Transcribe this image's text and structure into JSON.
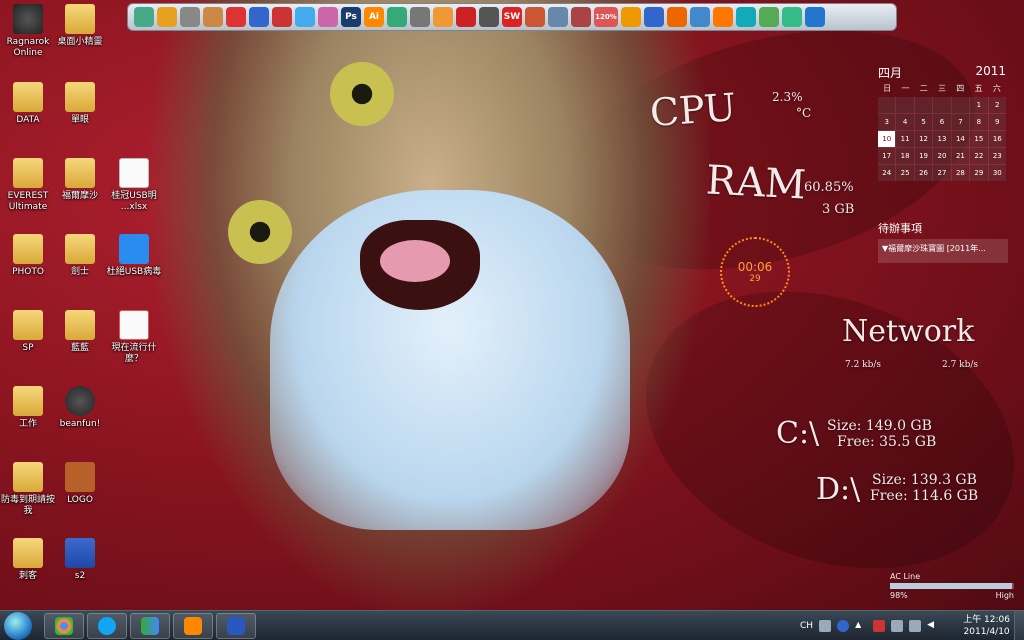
{
  "desktop_icons": [
    {
      "label": "Ragnarok Online",
      "type": "app"
    },
    {
      "label": "DATA",
      "type": "folder"
    },
    {
      "label": "EVEREST Ultimate",
      "type": "folder"
    },
    {
      "label": "PHOTO",
      "type": "folder"
    },
    {
      "label": "SP",
      "type": "folder"
    },
    {
      "label": "工作",
      "type": "folder"
    },
    {
      "label": "防毒到期請按我",
      "type": "folder"
    },
    {
      "label": "刺客",
      "type": "folder"
    },
    {
      "label": "桌面小精靈",
      "type": "folder"
    },
    {
      "label": "單眼",
      "type": "folder"
    },
    {
      "label": "福爾摩沙",
      "type": "folder"
    },
    {
      "label": "劍士",
      "type": "folder"
    },
    {
      "label": "藍藍",
      "type": "folder"
    },
    {
      "label": "beanfun!",
      "type": "app"
    },
    {
      "label": "LOGO",
      "type": "app"
    },
    {
      "label": "s2",
      "type": "doc"
    },
    {
      "label": "桂冠USB明 ...xlsx",
      "type": "doc"
    },
    {
      "label": "杜絕USB病毒",
      "type": "app"
    },
    {
      "label": "現在流行什麼？",
      "type": "doc"
    }
  ],
  "dock_icons": [
    "monitor-icon",
    "folder-icon",
    "pen-icon",
    "clipboard-icon",
    "tool-icon",
    "globe-icon",
    "toolbox-icon",
    "drop-icon",
    "paint-icon",
    "photoshop-icon",
    "illustrator-icon",
    "earth-icon",
    "gear-icon",
    "help-icon",
    "pdf-icon",
    "mouse-icon",
    "swf-icon",
    "capture-icon",
    "notepad-icon",
    "video-icon",
    "zoom-icon",
    "calc-icon",
    "media-icon",
    "camera-icon",
    "music-icon",
    "game-icon",
    "skype-icon",
    "messenger-icon",
    "chrome-icon",
    "ie-icon"
  ],
  "dock_labels": {
    "ps": "Ps",
    "ai": "Ai",
    "sw": "SW",
    "zoom": "120%"
  },
  "gadgets": {
    "cpu_label": "CPU",
    "cpu_value": "2.3%",
    "cpu_temp": "°C",
    "ram_label": "RAM",
    "ram_value": "60.85%",
    "ram_total": "3 GB",
    "network_label": "Network",
    "net_down": "7.2 kb/s",
    "net_up": "2.7 kb/s",
    "c_drive": {
      "label": "C:\\",
      "size": "Size: 149.0 GB",
      "free": "Free: 35.5 GB"
    },
    "d_drive": {
      "label": "D:\\",
      "size": "Size: 139.3 GB",
      "free": "Free: 114.6 GB"
    }
  },
  "calendar": {
    "month": "四月",
    "year": "2011",
    "weekdays": [
      "日",
      "一",
      "二",
      "三",
      "四",
      "五",
      "六"
    ],
    "days": [
      "",
      "",
      "",
      "",
      "",
      "1",
      "2",
      "3",
      "4",
      "5",
      "6",
      "7",
      "8",
      "9",
      "10",
      "11",
      "12",
      "13",
      "14",
      "15",
      "16",
      "17",
      "18",
      "19",
      "20",
      "21",
      "22",
      "23",
      "24",
      "25",
      "26",
      "27",
      "28",
      "29",
      "30"
    ],
    "today": "10"
  },
  "todo": {
    "title": "待辦事項",
    "item": "▼福爾摩沙珠寶圖 [2011年..."
  },
  "clock": {
    "time": "00:06",
    "sub": "29"
  },
  "power": {
    "label": "AC Line",
    "percent": "98%",
    "level_text": "High",
    "level": 0.98
  },
  "taskbar": {
    "ime": "CH",
    "time": "上午 12:06",
    "date": "2011/4/10"
  },
  "colors": {
    "wallpaper": "#8c1520",
    "dock": "#d5dbe2",
    "taskbar": "#1c2530",
    "clock": "#ff8c1a"
  }
}
